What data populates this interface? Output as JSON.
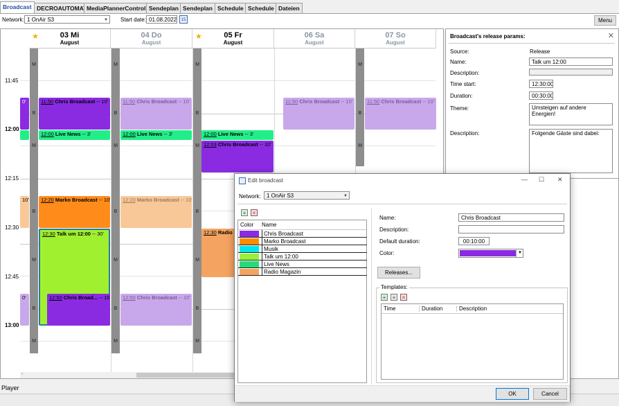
{
  "tabs": [
    "Broadcast",
    "DECROAUTOMAT",
    "MediaPlannerControl",
    "Sendeplan",
    "Sendeplan",
    "Schedule",
    "Schedule",
    "Dateien"
  ],
  "toolbar": {
    "network_label": "Network:",
    "network_value": "1 OnAir S3",
    "start_date_label": "Start date:",
    "start_date_value": "01.08.2022",
    "calendar_icon_text": "15",
    "menu_label": "Menu"
  },
  "days": [
    {
      "day": "03 Mi",
      "month": "August",
      "dim": false,
      "star": true
    },
    {
      "day": "04 Do",
      "month": "August",
      "dim": true,
      "star": false
    },
    {
      "day": "05 Fr",
      "month": "August",
      "dim": false,
      "star": true
    },
    {
      "day": "06 Sa",
      "month": "August",
      "dim": true,
      "star": false
    },
    {
      "day": "07 So",
      "month": "August",
      "dim": true,
      "star": false
    }
  ],
  "time_labels": [
    "11:45",
    "12:00",
    "12:15",
    "12:30",
    "12:45",
    "13:00"
  ],
  "strip_letters": {
    "m": "M",
    "b": "B"
  },
  "blocks": {
    "prev_chris": "0'",
    "prev_marko": "10'",
    "prev_bottom": "0'",
    "b03_chris": {
      "time": "11:50",
      "title": "Chris Broadcast",
      "dur": "-- 10'"
    },
    "b03_news": {
      "time": "12:00",
      "title": "Live News",
      "dur": "-- 3'"
    },
    "b03_marko": {
      "time": "12:20",
      "title": "Marko Broadcast",
      "dur": "-- 10'"
    },
    "b03_talk": {
      "time": "12:30",
      "title": "Talk um 12:00",
      "dur": "-- 30'"
    },
    "b03_chris2": {
      "time": "12:50",
      "title": "Chris Broad...",
      "dur": "-- 10'"
    },
    "b04_chris": {
      "time": "11:50",
      "title": "Chris Broadcast",
      "dur": "-- 10'"
    },
    "b04_news": {
      "time": "12:00",
      "title": "Live News",
      "dur": "-- 3'"
    },
    "b04_marko": {
      "time": "12:20",
      "title": "Marko Broadcast",
      "dur": "-- 10'"
    },
    "b04_chris2": {
      "time": "12:50",
      "title": "Chris Broadcast",
      "dur": "-- 10'"
    },
    "b05_news": {
      "time": "12:00",
      "title": "Live News",
      "dur": "-- 3'"
    },
    "b05_chris": {
      "time": "12:03",
      "title": "Chris Broadcast",
      "dur": "-- 10'"
    },
    "b05_radio": {
      "time": "12:30",
      "title": "Radio M",
      "dur": ""
    },
    "b06_chris": {
      "time": "11:50",
      "title": "Chris Broadcast",
      "dur": "-- 10'"
    },
    "b07_chris": {
      "time": "11:50",
      "title": "Chris Broadcast",
      "dur": "-- 10'"
    }
  },
  "release_params": {
    "title": "Broadcast's release params:",
    "source_label": "Source:",
    "source_value": "Release",
    "name_label": "Name:",
    "name_value": "Talk um 12:00",
    "description_label": "Description:",
    "description_value": "",
    "time_start_label": "Time start:",
    "time_start_value": "12:30:00",
    "duration_label": "Duration:",
    "duration_value": "00:30:00",
    "theme_label": "Theme:",
    "theme_value": "Umsteigen auf andere Energien!",
    "description2_label": "Description:",
    "description2_value": "Folgende Gäste sind dabei:"
  },
  "status_text": "Player",
  "dialog": {
    "title": "Edit broadcast",
    "network_label": "Network:",
    "network_value": "1 OnAir S3",
    "columns": {
      "color": "Color",
      "name": "Name"
    },
    "broadcasts": [
      {
        "name": "Chris Broadcast",
        "color": "#8a2be2"
      },
      {
        "name": "Marko Broadcast",
        "color": "#ff8c00"
      },
      {
        "name": "Musik",
        "color": "#00e5ee"
      },
      {
        "name": "Talk um 12:00",
        "color": "#98f03c"
      },
      {
        "name": "Live News",
        "color": "#22dd77"
      },
      {
        "name": "Radio Magazin",
        "color": "#f4a460"
      }
    ],
    "name_label": "Name:",
    "name_value": "Chris Broadcast",
    "description_label": "Description:",
    "description_value": "",
    "default_duration_label": "Default duration:",
    "default_duration_value": "00:10:00",
    "color_label": "Color:",
    "color_value": "#8a2be2",
    "releases_label": "Releases...",
    "templates_label": "Templates:",
    "template_columns": {
      "time": "Time",
      "duration": "Duration",
      "description": "Description"
    },
    "ok_label": "OK",
    "cancel_label": "Cancel"
  },
  "colors": {
    "chris": "#8a2be2",
    "chris_dim": "#c8a8ea",
    "news": "#22ee88",
    "marko": "#ff8c1a",
    "marko_dim": "#f8c898",
    "talk": "#a0f030",
    "radio": "#f4a460",
    "strip": "#8e8e8e"
  }
}
